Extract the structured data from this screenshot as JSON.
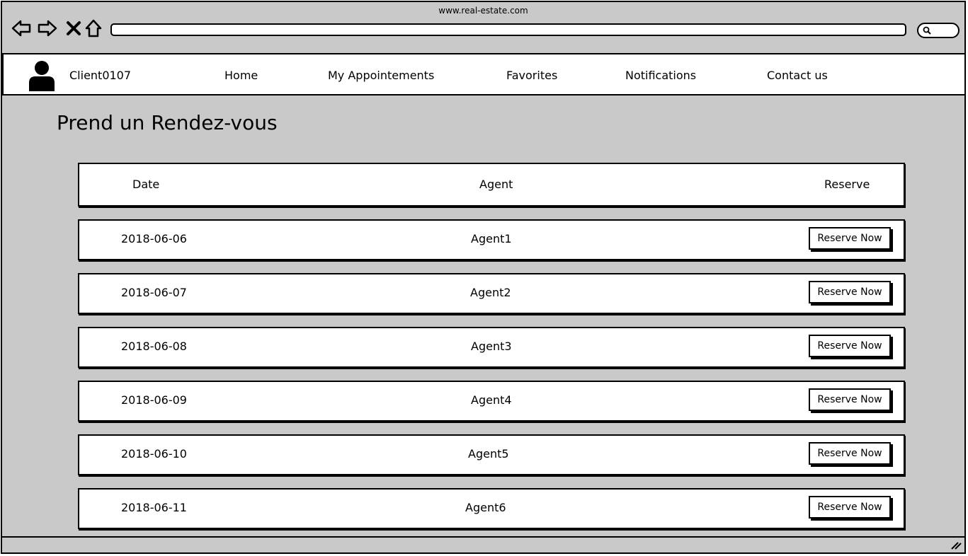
{
  "browser": {
    "url": "www.real-estate.com"
  },
  "navbar": {
    "username": "Client0107",
    "items": [
      {
        "label": "Home"
      },
      {
        "label": "My Appointements"
      },
      {
        "label": "Favorites"
      },
      {
        "label": "Notifications"
      },
      {
        "label": "Contact us"
      }
    ]
  },
  "page": {
    "title": "Prend un Rendez-vous"
  },
  "table": {
    "headers": {
      "date": "Date",
      "agent": "Agent",
      "reserve": "Reserve"
    },
    "rows": [
      {
        "date": "2018-06-06",
        "agent": "Agent1",
        "action": "Reserve Now"
      },
      {
        "date": "2018-06-07",
        "agent": "Agent2",
        "action": "Reserve Now"
      },
      {
        "date": "2018-06-08",
        "agent": "Agent3",
        "action": "Reserve Now"
      },
      {
        "date": "2018-06-09",
        "agent": "Agent4",
        "action": "Reserve Now"
      },
      {
        "date": "2018-06-10",
        "agent": "Agent5",
        "action": "Reserve Now"
      },
      {
        "date": "2018-06-11",
        "agent": "Agent6",
        "action": "Reserve Now"
      }
    ]
  },
  "icons": {
    "back": "back-arrow-icon",
    "forward": "forward-arrow-icon",
    "stop": "close-icon",
    "home": "home-icon",
    "search": "search-icon",
    "user": "user-avatar-icon",
    "resize": "resize-grip-icon"
  },
  "colors": {
    "page_background": "#c9c9c9",
    "panel_background": "#ffffff",
    "stroke": "#000000"
  }
}
